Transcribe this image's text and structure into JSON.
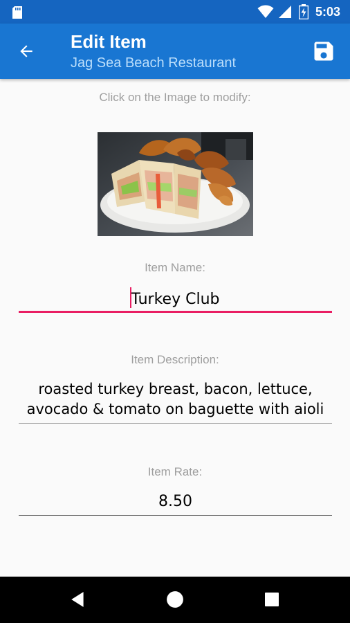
{
  "status_bar": {
    "time": "5:03",
    "icons": [
      "sd-card-icon",
      "wifi-icon",
      "signal-icon",
      "battery-charging-icon"
    ]
  },
  "app_bar": {
    "title": "Edit Item",
    "subtitle": "Jag Sea Beach Restaurant",
    "back_icon": "arrow-back-icon",
    "save_icon": "save-icon"
  },
  "form": {
    "image_hint": "Click on the Image to modify:",
    "item_name_label": "Item Name:",
    "item_name_value": "Turkey Club",
    "item_description_label": "Item Description:",
    "item_description_line1": "roasted turkey breast, bacon, lettuce,",
    "item_description_line2": "avocado & tomato on baguette with aioli",
    "item_rate_label": "Item Rate:",
    "item_rate_value": "8.50"
  },
  "nav_bar": {
    "buttons": [
      "back-triangle-icon",
      "home-circle-icon",
      "recents-square-icon"
    ]
  },
  "colors": {
    "status_bar": "#1565c0",
    "app_bar": "#1976d2",
    "subtitle": "#bbdefb",
    "focused_underline": "#e91e63",
    "label_gray": "#9e9e9e"
  }
}
